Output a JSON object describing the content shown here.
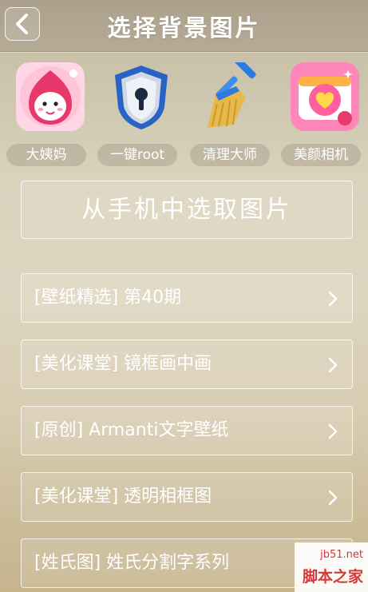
{
  "header": {
    "title": "选择背景图片"
  },
  "apps": [
    {
      "label": "大姨妈",
      "icon": "period-tracker-icon"
    },
    {
      "label": "一键root",
      "icon": "shield-lock-icon"
    },
    {
      "label": "清理大师",
      "icon": "broom-icon"
    },
    {
      "label": "美颜相机",
      "icon": "camera-heart-icon"
    }
  ],
  "pick_button": {
    "label": "从手机中选取图片"
  },
  "list": [
    {
      "label": "[壁纸精选] 第40期"
    },
    {
      "label": "[美化课堂] 镜框画中画"
    },
    {
      "label": "[原创] Armanti文字壁纸"
    },
    {
      "label": "[美化课堂] 透明相框图"
    },
    {
      "label": "[姓氏图] 姓氏分割字系列"
    }
  ],
  "watermark": {
    "url": "jb51.net",
    "name": "脚本之家"
  }
}
